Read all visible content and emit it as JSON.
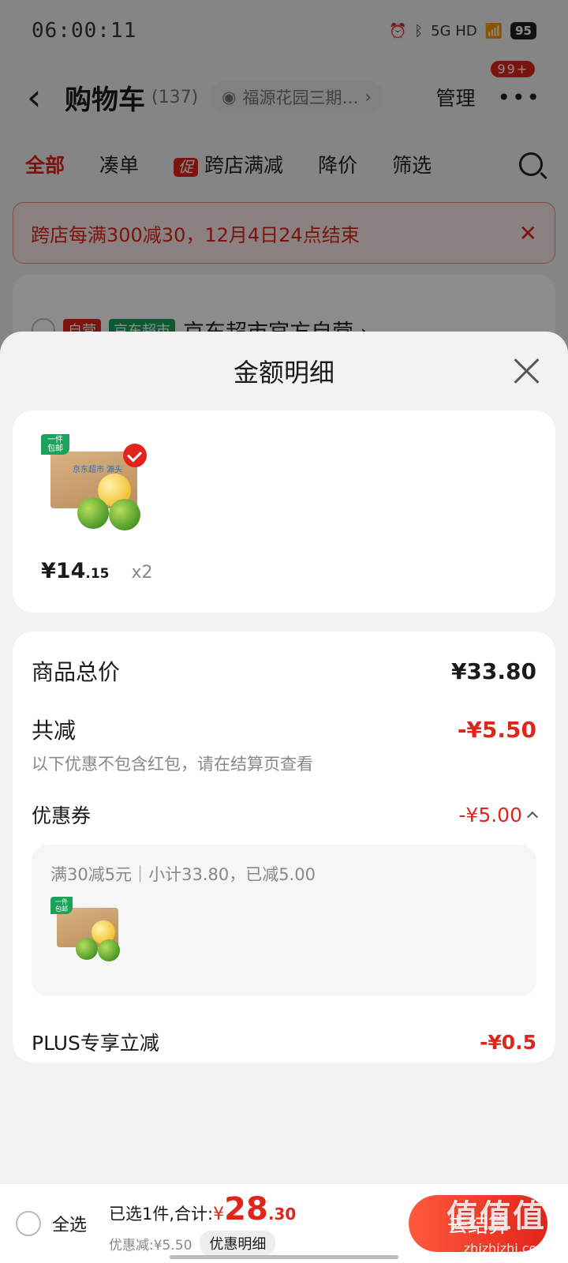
{
  "status_bar": {
    "time": "06:00:11",
    "network": "5G HD",
    "battery": "95"
  },
  "header": {
    "title": "购物车",
    "count": "(137)",
    "address": "福源花园三期…",
    "manage": "管理",
    "more_badge": "99+"
  },
  "tabs": [
    {
      "label": "全部"
    },
    {
      "label": "凑单"
    },
    {
      "label": "跨店满减",
      "tag": "促"
    },
    {
      "label": "降价"
    },
    {
      "label": "筛选"
    }
  ],
  "banner": {
    "text": "跨店每满300减30，12月4日24点结束"
  },
  "shop": {
    "tag_self": "自营",
    "tag_market": "京东超市",
    "name": "京东超市官方自营 ›"
  },
  "sheet": {
    "title": "金额明细",
    "product": {
      "corner_tag": "一件包邮",
      "box_label": "京东超市 源头",
      "price_int": "¥14",
      "price_dec": ".15",
      "qty": "x2"
    },
    "total_label": "商品总价",
    "total_value": "¥33.80",
    "reduce_label": "共减",
    "reduce_value": "-¥5.50",
    "reduce_note": "以下优惠不包含红包，请在结算页查看",
    "coupon_label": "优惠券",
    "coupon_value": "-¥5.00",
    "coupon_detail": "满30减5元｜小计33.80，已减5.00",
    "plus_label": "PLUS专享立减",
    "plus_value": "-¥0.5"
  },
  "bottom_bar": {
    "select_all": "全选",
    "selected_prefix": "已选1件,合计:",
    "total_yen": "¥",
    "total_int": "28",
    "total_dec": ".30",
    "discount": "优惠减:¥5.50",
    "detail_button": "优惠明细",
    "checkout": "去结算"
  },
  "watermark": {
    "text": "值值值",
    "url": "zhizhizhi.com"
  }
}
